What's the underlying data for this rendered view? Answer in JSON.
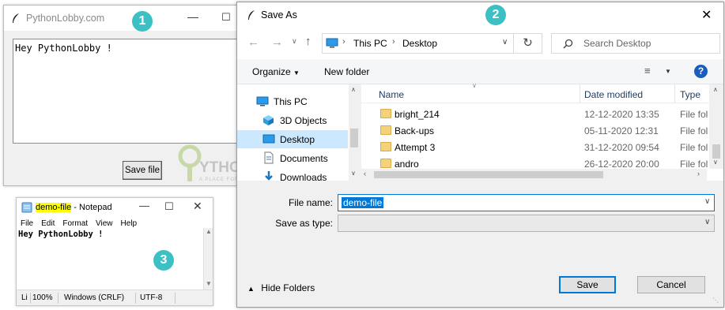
{
  "tk_window": {
    "title": "PythonLobby.com",
    "text_content": "Hey PythonLobby !",
    "save_button_label": "Save file"
  },
  "badges": {
    "one": "1",
    "two": "2",
    "three": "3"
  },
  "watermark": {
    "main": "PYTHONLOBBY",
    "tagline": "A PLACE FOR SELF LEARNING"
  },
  "notepad": {
    "title_highlight": "demo-file",
    "title_rest": " - Notepad",
    "menu": [
      "File",
      "Edit",
      "Format",
      "View",
      "Help"
    ],
    "text_content": "Hey PythonLobby !",
    "status": {
      "pos": "Li",
      "zoom": "100%",
      "line_ending": "Windows (CRLF)",
      "encoding": "UTF-8"
    }
  },
  "save_dialog": {
    "title": "Save As",
    "address": [
      "This PC",
      "Desktop"
    ],
    "search_placeholder": "Search Desktop",
    "toolbar": {
      "organize": "Organize",
      "new_folder": "New folder"
    },
    "nav_items": [
      {
        "label": "This PC",
        "icon": "computer-icon",
        "selected": false
      },
      {
        "label": "3D Objects",
        "icon": "cube-icon",
        "selected": false
      },
      {
        "label": "Desktop",
        "icon": "desktop-icon",
        "selected": true
      },
      {
        "label": "Documents",
        "icon": "document-icon",
        "selected": false
      },
      {
        "label": "Downloads",
        "icon": "download-icon",
        "selected": false
      }
    ],
    "columns": {
      "name": "Name",
      "date": "Date modified",
      "type": "Type"
    },
    "files": [
      {
        "name": "bright_214",
        "date": "12-12-2020 13:35",
        "type": "File fol"
      },
      {
        "name": "Back-ups",
        "date": "05-11-2020 12:31",
        "type": "File fol"
      },
      {
        "name": "Attempt 3",
        "date": "31-12-2020 09:54",
        "type": "File fol"
      },
      {
        "name": "andro",
        "date": "26-12-2020 20:00",
        "type": "File fol"
      }
    ],
    "file_name_label": "File name:",
    "file_name_value": "demo-file",
    "save_as_type_label": "Save as type:",
    "save_as_type_value": "",
    "hide_folders": "Hide Folders",
    "save_label": "Save",
    "cancel_label": "Cancel",
    "colors": {
      "accent": "#0078d7",
      "selection": "#cce8ff",
      "badge": "#3cc0c4"
    }
  }
}
